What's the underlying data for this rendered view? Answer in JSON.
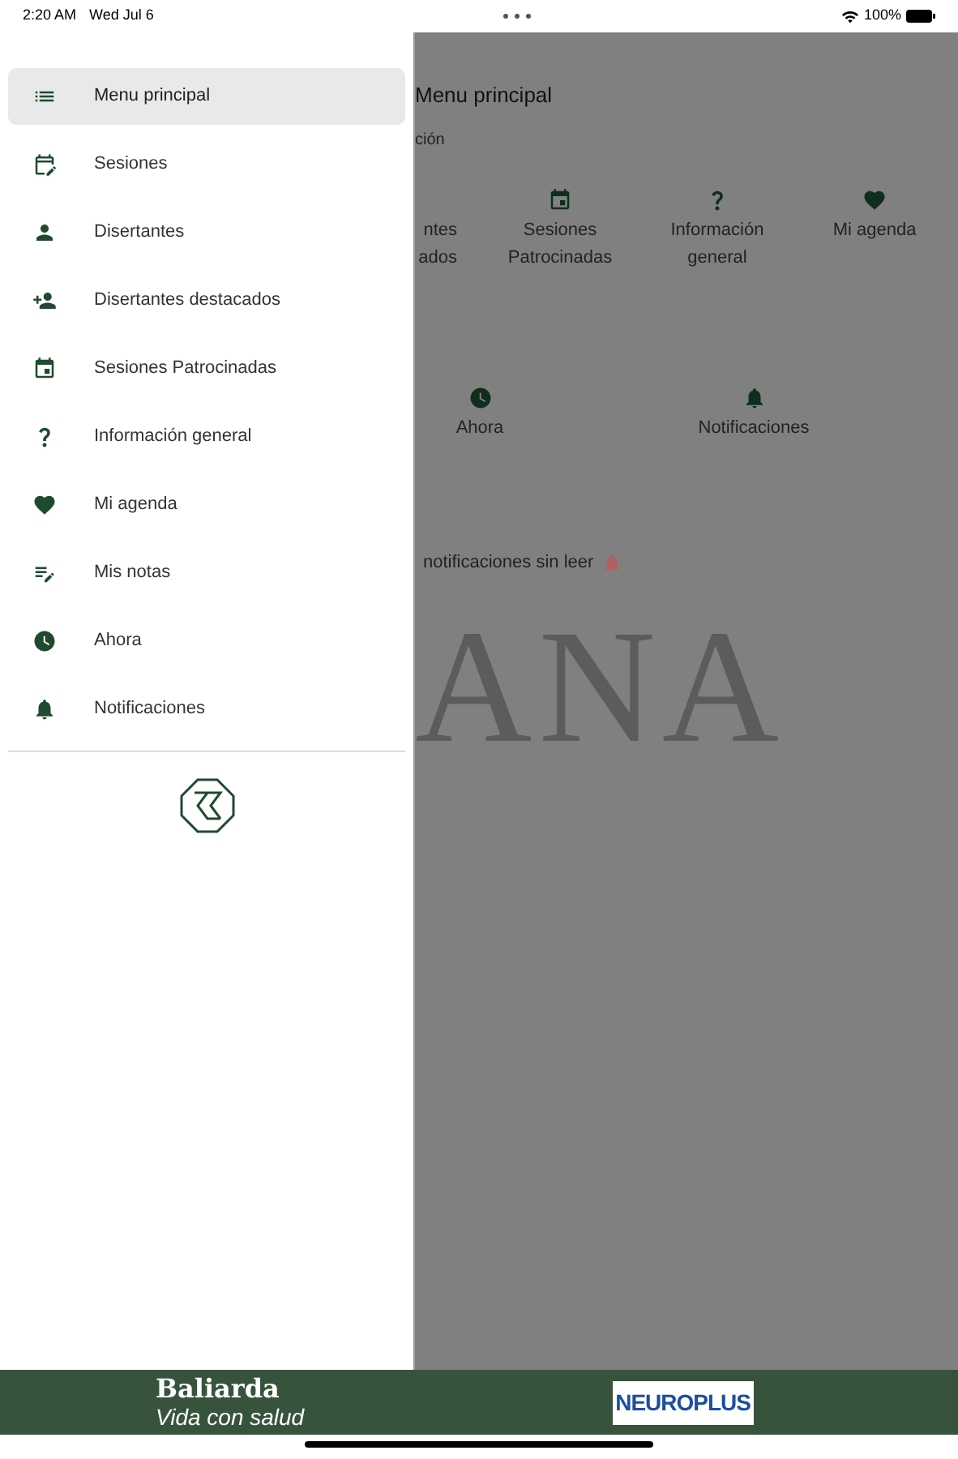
{
  "status_bar": {
    "time": "2:20 AM",
    "date": "Wed Jul 6",
    "battery": "100%"
  },
  "drawer": {
    "items": [
      {
        "label": "Menu principal",
        "selected": true
      },
      {
        "label": "Sesiones",
        "selected": false
      },
      {
        "label": "Disertantes",
        "selected": false
      },
      {
        "label": "Disertantes destacados",
        "selected": false
      },
      {
        "label": "Sesiones Patrocinadas",
        "selected": false
      },
      {
        "label": "Información general",
        "selected": false
      },
      {
        "label": "Mi agenda",
        "selected": false
      },
      {
        "label": "Mis notas",
        "selected": false
      },
      {
        "label": "Ahora",
        "selected": false
      },
      {
        "label": "Notificaciones",
        "selected": false
      }
    ]
  },
  "background_page": {
    "title": "Menu principal",
    "subtitle": "ción",
    "cut_tile": [
      "ntes",
      "ados"
    ],
    "tiles_row_1": [
      {
        "kind": "event",
        "label": "Sesiones Patrocinadas"
      },
      {
        "kind": "help",
        "label": "Información general"
      },
      {
        "kind": "heart",
        "label": "Mi agenda"
      }
    ],
    "tiles_row_2": [
      {
        "kind": "clock",
        "label": "Ahora"
      },
      {
        "kind": "bell",
        "label": "Notificaciones"
      }
    ],
    "notice": "notificaciones sin leer",
    "logo": "ANA"
  },
  "banner": {
    "brand": "Baliarda",
    "tagline": "Vida con salud",
    "product": "NEUROPLUS"
  }
}
